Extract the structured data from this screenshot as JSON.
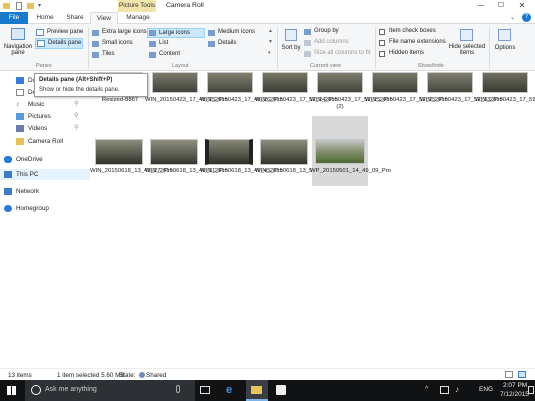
{
  "window": {
    "context_tab": "Picture Tools",
    "title": "Camera Roll"
  },
  "tabs": {
    "file": "File",
    "home": "Home",
    "share": "Share",
    "view": "View",
    "manage": "Manage"
  },
  "ribbon": {
    "panes": {
      "navigation_pane": "Navigation pane",
      "preview_pane": "Preview pane",
      "details_pane": "Details pane",
      "group_label": "Panes"
    },
    "layout": {
      "extra_large_icons": "Extra large icons",
      "large_icons": "Large icons",
      "medium_icons": "Medium icons",
      "small_icons": "Small icons",
      "list": "List",
      "details": "Details",
      "tiles": "Tiles",
      "content": "Content",
      "group_label": "Layout"
    },
    "current_view": {
      "sort_by": "Sort by",
      "group_by": "Group by",
      "add_columns": "Add columns",
      "size_columns": "Size all columns to fit",
      "group_label": "Current view"
    },
    "show_hide": {
      "item_check_boxes": "Item check boxes",
      "file_name_extensions": "File name extensions",
      "hidden_items": "Hidden items",
      "hide_selected_items": "Hide selected items",
      "group_label": "Show/hide"
    },
    "options": "Options"
  },
  "tooltip": {
    "title": "Details pane (Alt+Shift+P)",
    "body": "Show or hide the details pane."
  },
  "nav": {
    "items": [
      {
        "label": "Do"
      },
      {
        "label": "Do"
      },
      {
        "label": "Music"
      },
      {
        "label": "Pictures"
      },
      {
        "label": "Videos"
      },
      {
        "label": "Camera Roll"
      },
      {
        "label": "OneDrive"
      },
      {
        "label": "This PC"
      },
      {
        "label": "Network"
      },
      {
        "label": "Homegroup"
      }
    ]
  },
  "files": {
    "row1": [
      "Resized-8867",
      "WIN_20150423_17_48_25_Pro",
      "WIN_20150423_17_48_26_Pro",
      "WIN_20150423_17_52_24_Pro",
      "WIN_20150423_17_52_25_Pro (2)",
      "WIN_20150423_17_52_25_Pro",
      "WIN_20150423_17_52_33_Pro",
      "WIN_20150423_17_59_25_Pro"
    ],
    "row2": [
      "WIN_20150618_13_43_27_Pro",
      "WIN_20150618_13_46_31_Pro",
      "WIN_20150618_13_49_45_Pro",
      "WIN_20150618_13_54_48_Pro",
      "WP_20150501_14_49_09_Pro"
    ]
  },
  "status": {
    "count": "13 items",
    "selected": "1 item selected  5.60 MB",
    "state_label": "State:",
    "state_value": "Shared"
  },
  "taskbar": {
    "search_placeholder": "Ask me anything",
    "language": "ENG",
    "time": "2:07 PM",
    "date": "7/12/2015"
  },
  "colors": {
    "accent_blue": "#1979ca",
    "picture_tools": "#f0e4a8",
    "selection": "#cce8ff",
    "taskbar": "#101214"
  }
}
